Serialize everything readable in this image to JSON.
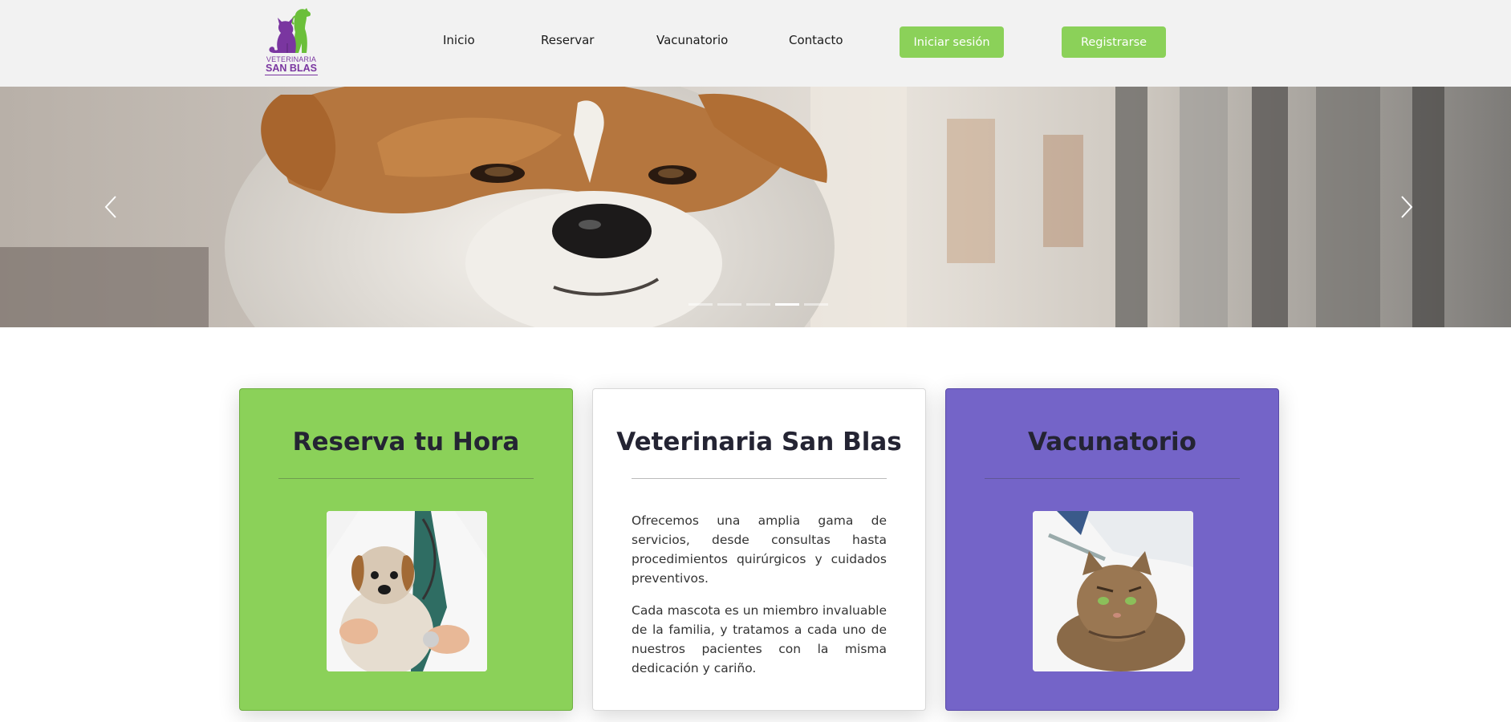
{
  "brand": {
    "logo_line1": "VETERINARIA",
    "logo_line2": "SAN BLAS",
    "logo_icon": "cat-and-dog-silhouette-icon",
    "colors": {
      "purple": "#7a36a0",
      "green": "#6bbf3a"
    }
  },
  "nav": {
    "links": [
      "Inicio",
      "Reservar",
      "Vacunatorio",
      "Contacto"
    ],
    "login_label": "Iniciar sesión",
    "register_label": "Registrarse"
  },
  "hero": {
    "image": "jack-russell-terrier-closeup",
    "prev_icon": "chevron-left-icon",
    "next_icon": "chevron-right-icon",
    "slides_count": 5,
    "active_slide": 4
  },
  "cards": [
    {
      "title": "Reserva tu Hora",
      "image": "vet-holding-terrier-puppy",
      "color": "#8bd159"
    },
    {
      "title": "Veterinaria San Blas",
      "paragraphs": [
        "Ofrecemos una amplia gama de servicios, desde consultas hasta procedimientos quirúrgicos y cuidados preventivos.",
        "Cada mascota es un miembro invaluable de la familia, y tratamos a cada uno de nuestros pacientes con la misma dedicación y cariño."
      ],
      "color": "#ffffff"
    },
    {
      "title": "Vacunatorio",
      "image": "tabby-cat-receiving-vaccine",
      "color": "#7464c8"
    }
  ]
}
